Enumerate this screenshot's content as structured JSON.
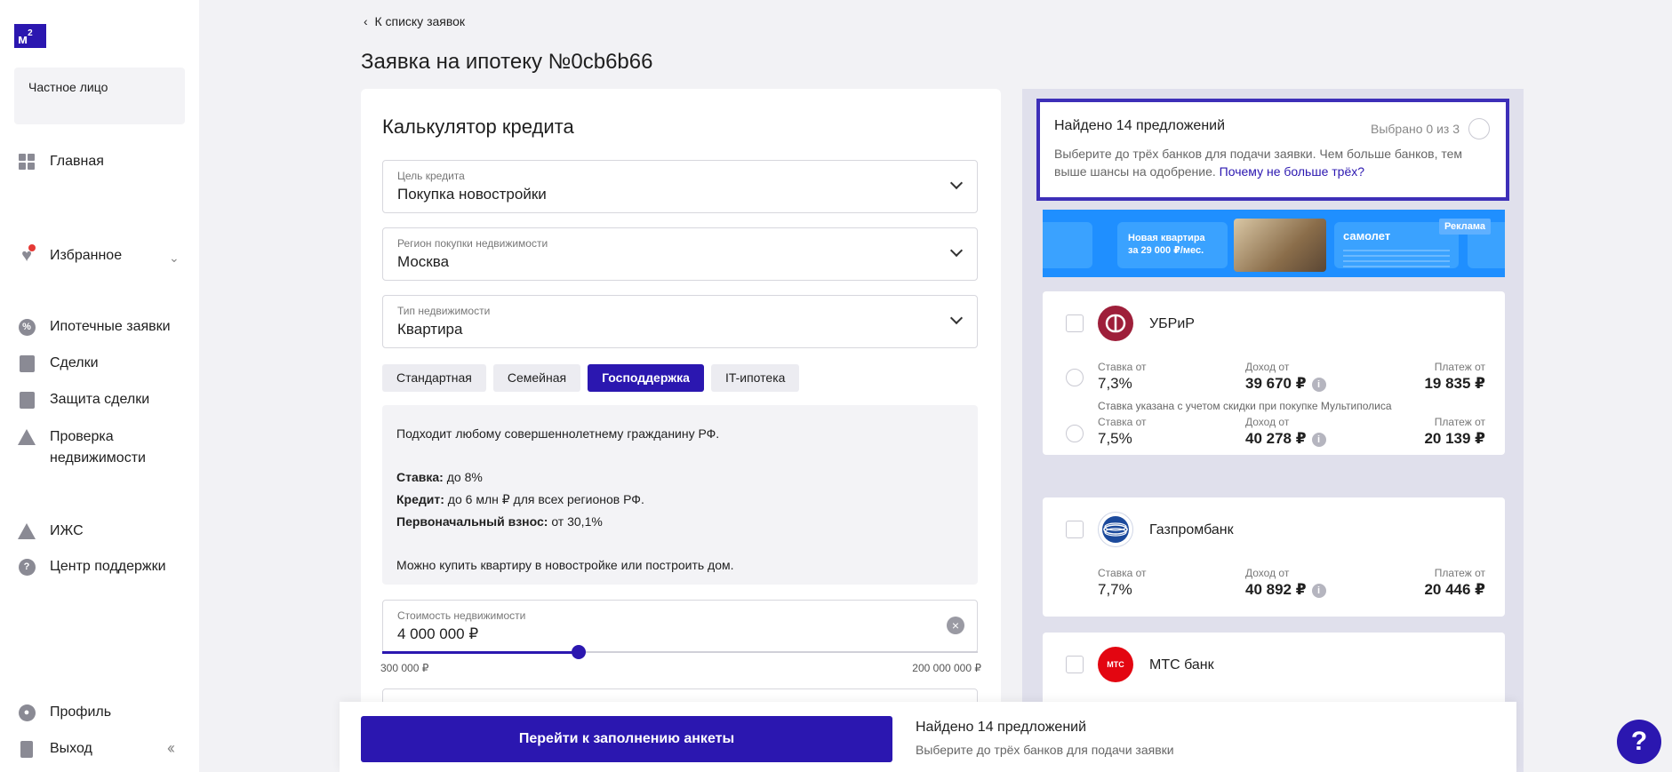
{
  "brand": {
    "logo_text": "м",
    "logo_sup": "2"
  },
  "account": {
    "type_label": "Частное лицо"
  },
  "nav": {
    "home": "Главная",
    "favorites": "Избранное",
    "mortgage_requests": "Ипотечные заявки",
    "deals": "Сделки",
    "deal_protection": "Защита сделки",
    "property_check_1": "Проверка",
    "property_check_2": "недвижимости",
    "izhs": "ИЖС",
    "support": "Центр поддержки",
    "profile": "Профиль",
    "logout": "Выход"
  },
  "header": {
    "back_link": "К списку заявок",
    "title": "Заявка на ипотеку №0cb6b66"
  },
  "calculator": {
    "title": "Калькулятор кредита",
    "purpose": {
      "label": "Цель кредита",
      "value": "Покупка новостройки"
    },
    "region": {
      "label": "Регион покупки недвижимости",
      "value": "Москва"
    },
    "property_type": {
      "label": "Тип недвижимости",
      "value": "Квартира"
    },
    "tabs": [
      "Стандартная",
      "Семейная",
      "Господдержка",
      "IT-ипотека"
    ],
    "active_tab": "Господдержка",
    "info": {
      "intro": "Подходит любому совершеннолетнему гражданину РФ.",
      "rate_label": "Ставка:",
      "rate_value": " до 8%",
      "credit_label": "Кредит:",
      "credit_value": " до 6 млн ₽ для всех регионов РФ.",
      "down_label": "Первоначальный взнос:",
      "down_value": " от 30,1%",
      "outro": "Можно купить квартиру в новостройке или построить дом."
    },
    "price": {
      "label": "Стоимость недвижимости",
      "value": "4 000 000 ₽",
      "min": "300 000 ₽",
      "max": "200 000 000 ₽",
      "slider_fraction": 0.33
    }
  },
  "offers": {
    "found_title": "Найдено 14 предложений",
    "selected_count": "Выбрано 0 из 3",
    "description": "Выберите до трёх банков для подачи заявки. Чем больше банков, тем выше шансы на одобрение. ",
    "description_link": "Почему не больше трёх?",
    "ad": {
      "headline_1": "Новая квартира",
      "headline_2": "за 29 000 ₽/мес.",
      "brand": "самолет",
      "tag": "Реклама"
    },
    "labels": {
      "rate": "Ставка от",
      "income": "Доход от",
      "payment": "Платеж от"
    },
    "banks": [
      {
        "name": "УБРиР",
        "logo_color": "#9e1f3a",
        "offers": [
          {
            "rate": "7,3%",
            "income": "39 670 ₽",
            "payment": "19 835 ₽",
            "note": "Ставка указана с учетом скидки при покупке Мультиполиса"
          },
          {
            "rate": "7,5%",
            "income": "40 278 ₽",
            "payment": "20 139 ₽"
          }
        ]
      },
      {
        "name": "Газпромбанк",
        "logo_color": "#1c4a9c",
        "offers": [
          {
            "rate": "7,7%",
            "income": "40 892 ₽",
            "payment": "20 446 ₽"
          }
        ]
      },
      {
        "name": "МТС банк",
        "logo_color": "#e30611",
        "logo_text": "МТС",
        "offers": []
      }
    ]
  },
  "bottom_bar": {
    "cta": "Перейти к заполнению анкеты",
    "title": "Найдено 14 предложений",
    "subtitle": "Выберите до трёх банков для подачи заявки"
  },
  "help": {
    "label": "?"
  },
  "colors": {
    "accent": "#2b17b0",
    "ad_blue": "#1f8fff",
    "offers_bg": "#e0e0ec"
  }
}
